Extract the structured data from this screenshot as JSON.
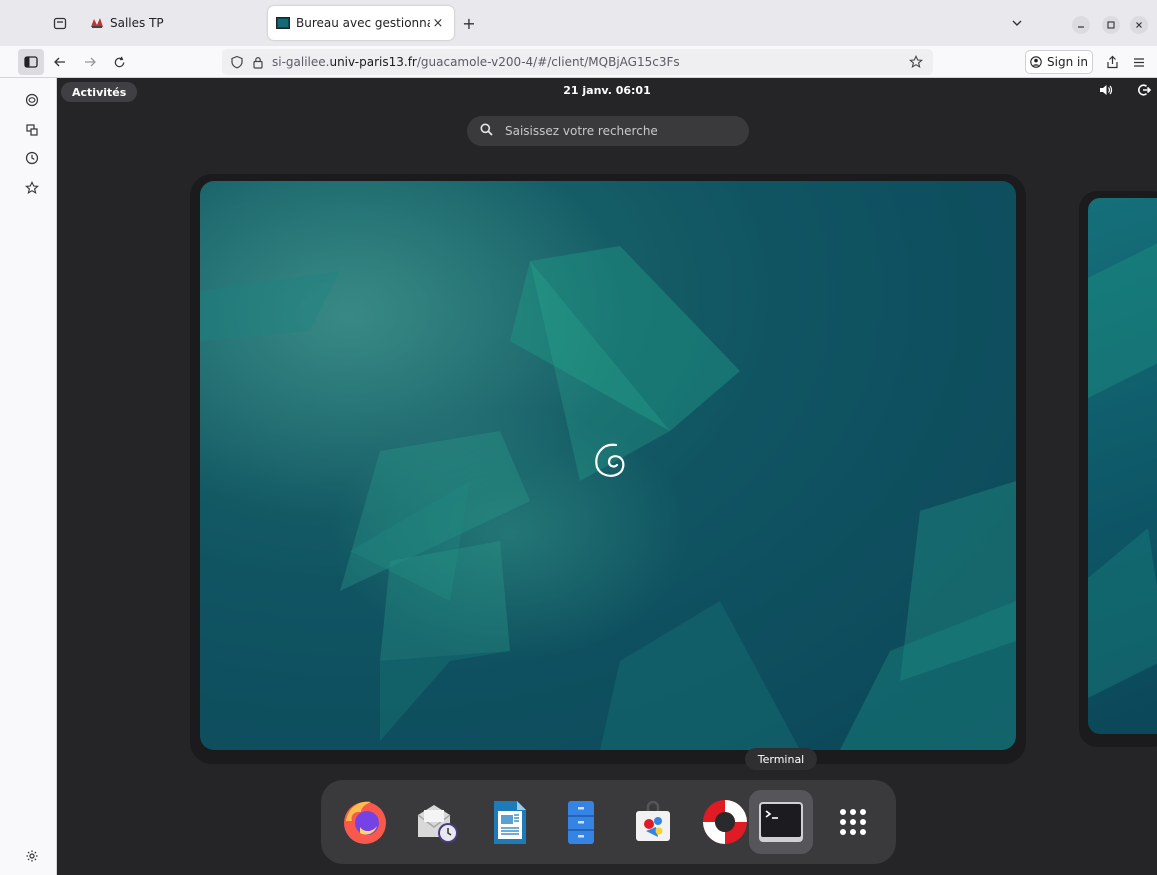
{
  "browser": {
    "tabs": [
      {
        "title": "Salles TP",
        "close": "×"
      },
      {
        "title": "Bureau avec gestionnaire",
        "close": "×"
      }
    ],
    "new_tab": "+",
    "url": {
      "prefix": "si-galilee.",
      "host": "univ-paris13.fr",
      "path": "/guacamole-v200-4/#/client/MQBjAG15c3Fs"
    },
    "sign_in": "Sign in"
  },
  "desktop": {
    "activities": "Activités",
    "clock": "21 janv.  06:01",
    "search_placeholder": "Saisissez votre recherche",
    "dock_tooltip": "Terminal",
    "dock_items": [
      "firefox-icon",
      "evolution-mail-icon",
      "libreoffice-writer-icon",
      "file-manager-icon",
      "software-store-icon",
      "help-icon",
      "terminal-icon",
      "app-grid-icon"
    ]
  },
  "colors": {
    "desktop_bg": "#252527",
    "wallpaper_teal": "#105462",
    "dock_bg": "#3a3a3d",
    "browser_chrome": "#e9e9ed"
  }
}
